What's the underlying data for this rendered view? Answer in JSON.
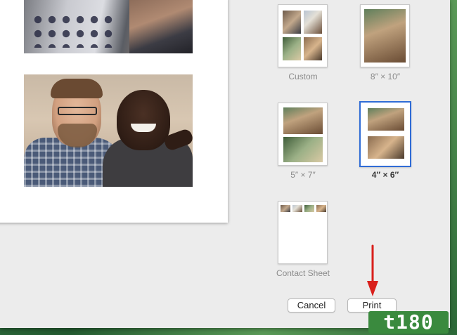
{
  "print_dialog": {
    "size_options": [
      {
        "label": "Custom",
        "selected": false
      },
      {
        "label": "8″ × 10″",
        "selected": false
      },
      {
        "label": "5″ × 7″",
        "selected": false
      },
      {
        "label": "4″ × 6″",
        "selected": true
      },
      {
        "label": "Contact Sheet",
        "selected": false
      }
    ],
    "buttons": {
      "cancel": "Cancel",
      "print": "Print"
    }
  },
  "annotation": {
    "arrow_color": "#d9201c"
  },
  "watermark": {
    "text": "t180"
  },
  "colors": {
    "selection_border": "#2f6cd6",
    "dialog_bg": "#ececec"
  }
}
